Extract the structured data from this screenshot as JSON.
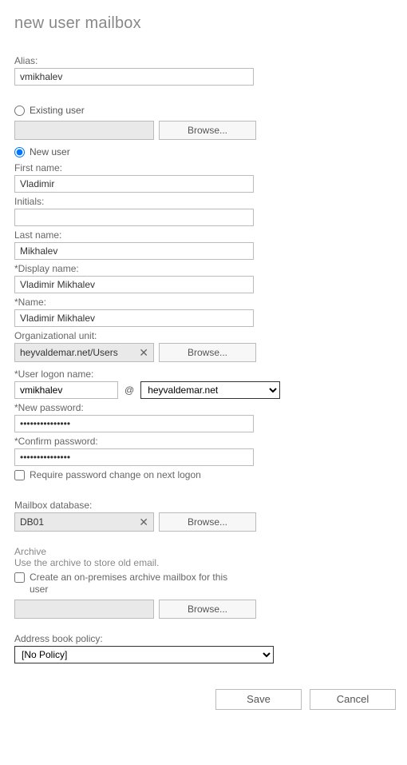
{
  "title": "new user mailbox",
  "alias": {
    "label": "Alias:",
    "value": "vmikhalev"
  },
  "userType": {
    "existing": {
      "label": "Existing user",
      "selected": false,
      "browse": "Browse..."
    },
    "newUser": {
      "label": "New user",
      "selected": true
    }
  },
  "form": {
    "firstName": {
      "label": "First name:",
      "value": "Vladimir"
    },
    "initials": {
      "label": "Initials:",
      "value": ""
    },
    "lastName": {
      "label": "Last name:",
      "value": "Mikhalev"
    },
    "displayName": {
      "label": "*Display name:",
      "value": "Vladimir Mikhalev"
    },
    "name": {
      "label": "*Name:",
      "value": "Vladimir Mikhalev"
    },
    "ou": {
      "label": "Organizational unit:",
      "value": "heyvaldemar.net/Users",
      "browse": "Browse..."
    },
    "logon": {
      "label": "*User logon name:",
      "local": "vmikhalev",
      "at": "@",
      "domain": "heyvaldemar.net"
    },
    "newPassword": {
      "label": "*New password:",
      "value": "•••••••••••••••"
    },
    "confirmPassword": {
      "label": "*Confirm password:",
      "value": "•••••••••••••••"
    },
    "requirePwdChange": {
      "label": "Require password change on next logon",
      "checked": false
    }
  },
  "mailboxDb": {
    "label": "Mailbox database:",
    "value": "DB01",
    "browse": "Browse..."
  },
  "archive": {
    "label": "Archive",
    "hint": "Use the archive to store old email.",
    "checkLabel": "Create an on-premises archive mailbox for this user",
    "checked": false,
    "browse": "Browse..."
  },
  "abp": {
    "label": "Address book policy:",
    "selected": "[No Policy]"
  },
  "buttons": {
    "save": "Save",
    "cancel": "Cancel"
  }
}
